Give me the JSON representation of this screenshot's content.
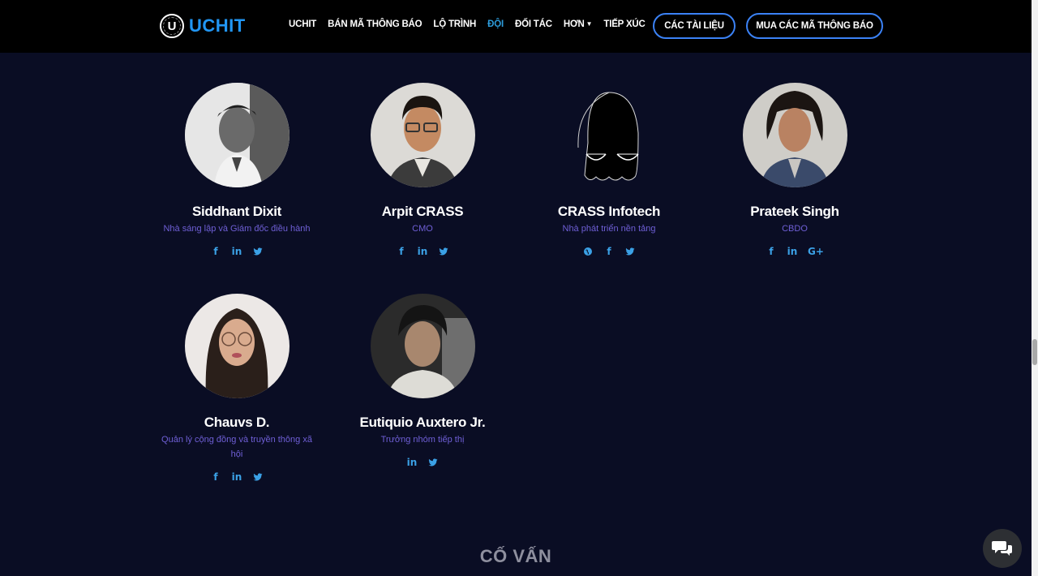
{
  "brand": {
    "logo_letter": "U",
    "name": "UCHIT"
  },
  "nav": {
    "links": [
      {
        "label": "UCHIT"
      },
      {
        "label": "BÁN MÃ THÔNG BÁO"
      },
      {
        "label": "LỘ TRÌNH"
      },
      {
        "label": "ĐỘI",
        "active": true
      },
      {
        "label": "ĐỐI TÁC"
      },
      {
        "label": "HƠN"
      },
      {
        "label": "TIẾP XÚC"
      }
    ],
    "docs_button": "CÁC TÀI LIỆU",
    "buy_button": "MUA CÁC MÃ THÔNG BÁO"
  },
  "team": [
    {
      "name": "Siddhant Dixit",
      "role": "Nhà sáng lập và Giám đốc điều hành",
      "socials": [
        "facebook-icon",
        "linkedin-icon",
        "twitter-icon"
      ]
    },
    {
      "name": "Arpit CRASS",
      "role": "CMO",
      "socials": [
        "facebook-icon",
        "linkedin-icon",
        "twitter-icon"
      ]
    },
    {
      "name": "CRASS Infotech",
      "role": "Nhà phát triển nền tảng",
      "socials": [
        "globe-icon",
        "facebook-icon",
        "twitter-icon"
      ]
    },
    {
      "name": "Prateek Singh",
      "role": "CBDO",
      "socials": [
        "facebook-icon",
        "linkedin-icon",
        "google-plus-icon"
      ]
    },
    {
      "name": "Chauvs D.",
      "role": "Quản lý cộng đồng và truyền thông xã hội",
      "socials": [
        "facebook-icon",
        "linkedin-icon",
        "twitter-icon"
      ]
    },
    {
      "name": "Eutiquio Auxtero Jr.",
      "role": "Trưởng nhóm tiếp thị",
      "socials": [
        "linkedin-icon",
        "twitter-icon"
      ]
    }
  ],
  "advisors_title": "CỐ VẤN",
  "colors": {
    "background": "#0a0d24",
    "navbar": "#000000",
    "brand_blue": "#2196f3",
    "active_link": "#2d9cdb",
    "role_text": "#6f5fd6",
    "social_icon": "#3ba1e6"
  }
}
